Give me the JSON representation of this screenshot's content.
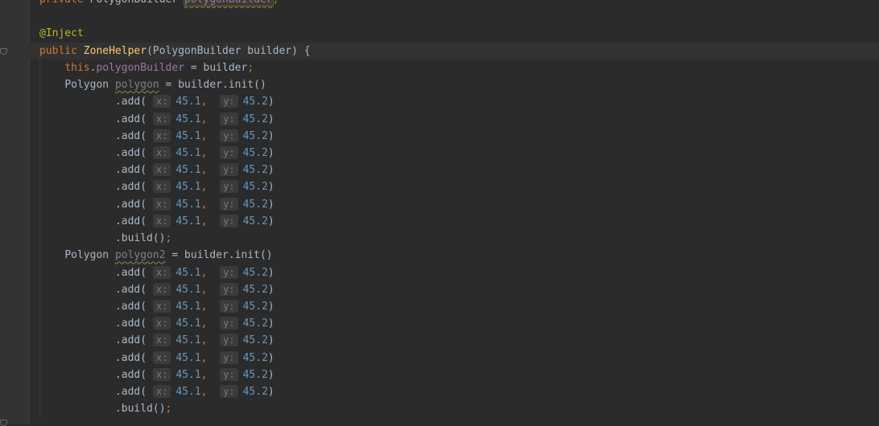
{
  "editor": {
    "field_decl": {
      "kw": "private",
      "type": "PolygonBuilder",
      "name": "polygonBuilder",
      "end": ";"
    },
    "annotation": "@Inject",
    "ctor": {
      "kw": "public",
      "name": "ZoneHelper",
      "open": "(",
      "params": "PolygonBuilder builder",
      "close": ") {"
    },
    "assign": {
      "this_kw": "this",
      "dot": ".",
      "field": "polygonBuilder",
      "rest": " = builder",
      "end": ";"
    },
    "poly1": {
      "type": "Polygon",
      "name": "polygon",
      "rest": " = builder.init()"
    },
    "poly2": {
      "type": "Polygon",
      "name": "polygon2",
      "rest": " = builder.init()"
    },
    "add_call": {
      "prefix": ".add(",
      "hint_x": "x:",
      "x_value": "45.1",
      "comma": ",",
      "hint_y": "y:",
      "y_value": "45.2",
      "suffix": ")"
    },
    "build_call": {
      "text": ".build()",
      "end": ";"
    }
  }
}
